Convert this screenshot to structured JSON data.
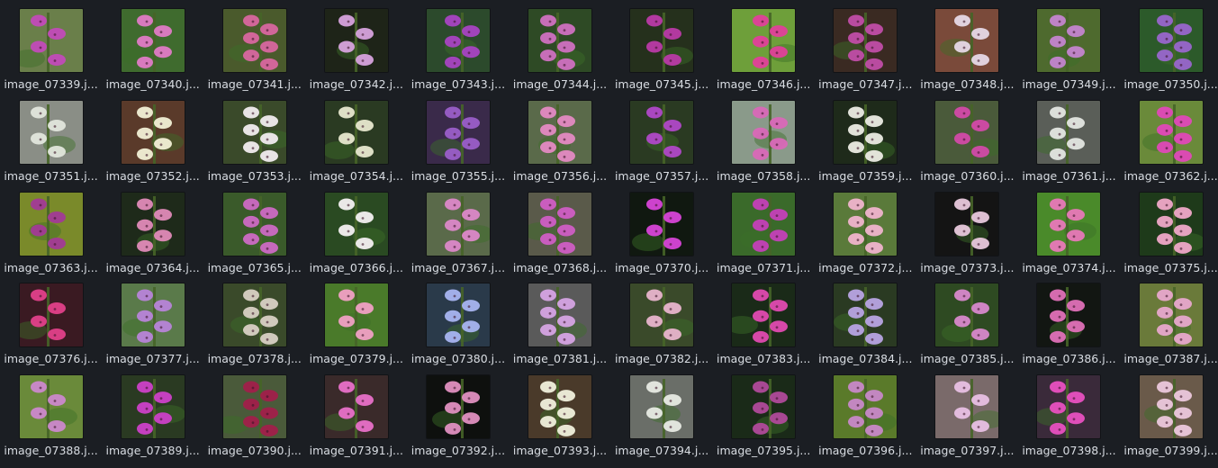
{
  "file_grid": {
    "items": [
      {
        "name": "image_07339.j...",
        "bg": "#6a7f4a",
        "flower": "#c24bb8"
      },
      {
        "name": "image_07340.j...",
        "bg": "#3f6b2e",
        "flower": "#e07bc6"
      },
      {
        "name": "image_07341.j...",
        "bg": "#4a5a2c",
        "flower": "#d8679f"
      },
      {
        "name": "image_07342.j...",
        "bg": "#1e2418",
        "flower": "#d7a3dd"
      },
      {
        "name": "image_07343.j...",
        "bg": "#2c4a2c",
        "flower": "#a843c2"
      },
      {
        "name": "image_07344.j...",
        "bg": "#2e4a25",
        "flower": "#d070c0"
      },
      {
        "name": "image_07345.j...",
        "bg": "#25301c",
        "flower": "#b93aa6"
      },
      {
        "name": "image_07346.j...",
        "bg": "#6e9f3a",
        "flower": "#e0409a"
      },
      {
        "name": "image_07347.j...",
        "bg": "#3a2a22",
        "flower": "#c04da8"
      },
      {
        "name": "image_07348.j...",
        "bg": "#7a4a3a",
        "flower": "#e6d8e6"
      },
      {
        "name": "image_07349.j...",
        "bg": "#4e6a2e",
        "flower": "#c485cf"
      },
      {
        "name": "image_07350.j...",
        "bg": "#2c5a2a",
        "flower": "#9966cc"
      },
      {
        "name": "image_07351.j...",
        "bg": "#8a8e86",
        "flower": "#e2e6dc"
      },
      {
        "name": "image_07352.j...",
        "bg": "#5a3a2a",
        "flower": "#f2f0d6"
      },
      {
        "name": "image_07353.j...",
        "bg": "#3a4a2a",
        "flower": "#f1ecef"
      },
      {
        "name": "image_07354.j...",
        "bg": "#2a3a22",
        "flower": "#e8e8d0"
      },
      {
        "name": "image_07355.j...",
        "bg": "#3a2a4a",
        "flower": "#9a5ec8"
      },
      {
        "name": "image_07356.j...",
        "bg": "#5a6a4a",
        "flower": "#e48ac2"
      },
      {
        "name": "image_07357.j...",
        "bg": "#2a3a22",
        "flower": "#b048c8"
      },
      {
        "name": "image_07358.j...",
        "bg": "#8a9a8a",
        "flower": "#d968b8"
      },
      {
        "name": "image_07359.j...",
        "bg": "#1e2a1a",
        "flower": "#ecece4"
      },
      {
        "name": "image_07360.j...",
        "bg": "#4a5a3a",
        "flower": "#d24aa8"
      },
      {
        "name": "image_07361.j...",
        "bg": "#5a5e58",
        "flower": "#e4e6e2"
      },
      {
        "name": "image_07362.j...",
        "bg": "#6a8a3a",
        "flower": "#e048b8"
      },
      {
        "name": "image_07363.j...",
        "bg": "#7a8a2a",
        "flower": "#a23a96"
      },
      {
        "name": "image_07364.j...",
        "bg": "#1e2a1a",
        "flower": "#e08ab8"
      },
      {
        "name": "image_07365.j...",
        "bg": "#3a5a2a",
        "flower": "#cc6ac4"
      },
      {
        "name": "image_07366.j...",
        "bg": "#2a4a22",
        "flower": "#f4f0f2"
      },
      {
        "name": "image_07367.j...",
        "bg": "#5a6a4a",
        "flower": "#dc88c8"
      },
      {
        "name": "image_07368.j...",
        "bg": "#5a5a4a",
        "flower": "#d05ec4"
      },
      {
        "name": "image_07370.j...",
        "bg": "#101810",
        "flower": "#d844d8"
      },
      {
        "name": "image_07371.j...",
        "bg": "#3a6a2a",
        "flower": "#c440b8"
      },
      {
        "name": "image_07372.j...",
        "bg": "#5a7a3a",
        "flower": "#f0b4cc"
      },
      {
        "name": "image_07373.j...",
        "bg": "#141414",
        "flower": "#e8c8dc"
      },
      {
        "name": "image_07374.j...",
        "bg": "#4a8a2a",
        "flower": "#e878b8"
      },
      {
        "name": "image_07375.j...",
        "bg": "#1e3a1a",
        "flower": "#f0a8c8"
      },
      {
        "name": "image_07376.j...",
        "bg": "#3a1a22",
        "flower": "#e0408a"
      },
      {
        "name": "image_07377.j...",
        "bg": "#5a7a4a",
        "flower": "#b884d8"
      },
      {
        "name": "image_07378.j...",
        "bg": "#3a4a2a",
        "flower": "#d8d0c4"
      },
      {
        "name": "image_07379.j...",
        "bg": "#4a7a2a",
        "flower": "#f0a0c4"
      },
      {
        "name": "image_07380.j...",
        "bg": "#2a3a4a",
        "flower": "#a8b4f0"
      },
      {
        "name": "image_07381.j...",
        "bg": "#5a5a5a",
        "flower": "#d6a4e4"
      },
      {
        "name": "image_07382.j...",
        "bg": "#3a4a2a",
        "flower": "#e8b4cc"
      },
      {
        "name": "image_07383.j...",
        "bg": "#1a2a18",
        "flower": "#e04ab0"
      },
      {
        "name": "image_07384.j...",
        "bg": "#2a3a22",
        "flower": "#b8a4e4"
      },
      {
        "name": "image_07385.j...",
        "bg": "#2e4a22",
        "flower": "#d888cc"
      },
      {
        "name": "image_07386.j...",
        "bg": "#121612",
        "flower": "#e070b8"
      },
      {
        "name": "image_07387.j...",
        "bg": "#6a7a3a",
        "flower": "#e8a8cc"
      },
      {
        "name": "image_07388.j...",
        "bg": "#6a8a3a",
        "flower": "#cc88cc"
      },
      {
        "name": "image_07389.j...",
        "bg": "#2a3a22",
        "flower": "#cc40c8"
      },
      {
        "name": "image_07390.j...",
        "bg": "#4a5a3a",
        "flower": "#a0204a"
      },
      {
        "name": "image_07391.j...",
        "bg": "#3a2a2a",
        "flower": "#e870c8"
      },
      {
        "name": "image_07392.j...",
        "bg": "#0e100e",
        "flower": "#e090c0"
      },
      {
        "name": "image_07393.j...",
        "bg": "#4a3a2a",
        "flower": "#f0f0dc"
      },
      {
        "name": "image_07394.j...",
        "bg": "#6a6e68",
        "flower": "#e8eae4"
      },
      {
        "name": "image_07395.j...",
        "bg": "#1a2a18",
        "flower": "#b04a9a"
      },
      {
        "name": "image_07396.j...",
        "bg": "#5a7a2a",
        "flower": "#c888c8"
      },
      {
        "name": "image_07397.j...",
        "bg": "#7a6a6a",
        "flower": "#e8c0e4"
      },
      {
        "name": "image_07398.j...",
        "bg": "#3a2a3a",
        "flower": "#e850c0"
      },
      {
        "name": "image_07399.j...",
        "bg": "#6a5a4a",
        "flower": "#ecc8dc"
      }
    ]
  }
}
